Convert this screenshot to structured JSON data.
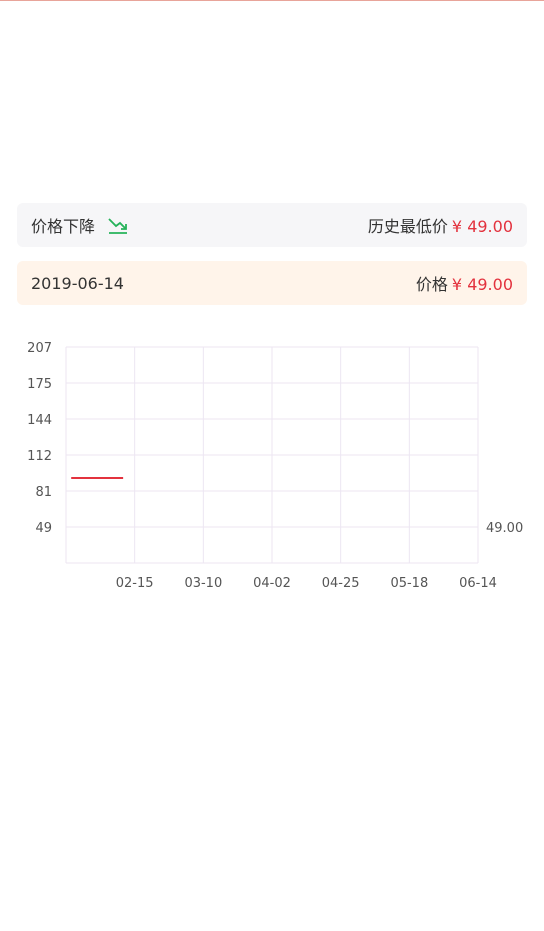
{
  "summary": {
    "trend_label": "价格下降",
    "trend_icon": "trend-down-icon",
    "lowest_label": "历史最低价",
    "lowest_price": "¥ 49.00"
  },
  "current": {
    "date": "2019-06-14",
    "price_label": "价格",
    "price": "¥ 49.00"
  },
  "colors": {
    "accent_red": "#e3323e",
    "trend_green": "#26b35a",
    "summary_bg": "#f6f6f8",
    "date_bg": "#fff4ea",
    "grid": "#ece6f2"
  },
  "chart_data": {
    "type": "line",
    "y_ticks": [
      "207",
      "175",
      "144",
      "112",
      "81",
      "49"
    ],
    "x_ticks": [
      "02-15",
      "03-10",
      "04-02",
      "04-25",
      "05-18",
      "06-14"
    ],
    "series": [
      {
        "x": [
          "01-24",
          "02-11"
        ],
        "values": [
          92,
          92
        ]
      }
    ],
    "end_label": "49.00",
    "grid": true
  }
}
